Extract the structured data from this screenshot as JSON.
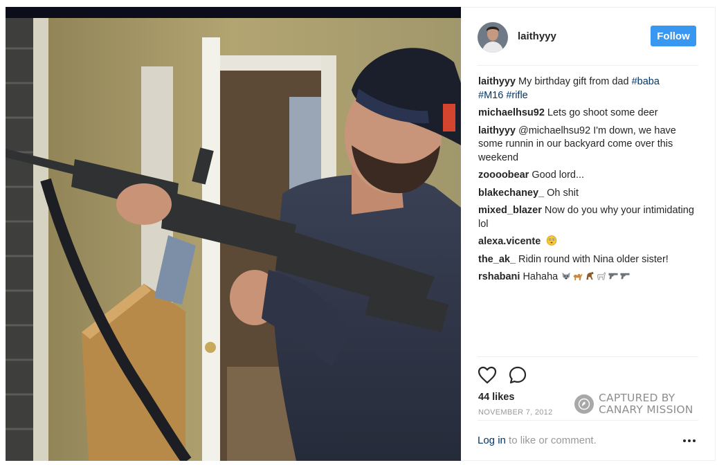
{
  "post": {
    "username": "laithyyy",
    "follow_label": "Follow",
    "photo_alt": "Man in backwards cap holding a rifle in a hallway"
  },
  "comments": [
    {
      "author": "laithyyy",
      "text": "My birthday gift from dad ",
      "tags": [
        "#baba",
        "#M16",
        "#rifle"
      ]
    },
    {
      "author": "michaelhsu92",
      "text": "Lets go shoot some deer"
    },
    {
      "author": "laithyyy",
      "text": "@michaelhsu92 I'm down, we have some runnin in our backyard come over this weekend"
    },
    {
      "author": "zoooobear",
      "text": "Good lord..."
    },
    {
      "author": "blakechaney_",
      "text": "Oh shit"
    },
    {
      "author": "mixed_blazer",
      "text": "Now do you why your intimidating lol"
    },
    {
      "author": "alexa.vicente",
      "text": ""
    },
    {
      "author": "the_ak_",
      "text": "Ridin round with Nina older sister!"
    },
    {
      "author": "rshabani",
      "text": "Hahaha"
    }
  ],
  "engagement": {
    "likes": "44 likes",
    "date": "NOVEMBER 7, 2012"
  },
  "watermark": {
    "line1": "CAPTURED BY",
    "line2": "CANARY MISSION"
  },
  "footer": {
    "login_label": "Log in",
    "login_suffix": " to like or comment."
  },
  "icons": {
    "like": "heart-outline-icon",
    "comment": "speech-bubble-icon",
    "more": "ellipsis-icon",
    "watermark": "canary-bird-icon"
  },
  "colors": {
    "follow_bg": "#3897f0",
    "link": "#003569",
    "muted": "#999999"
  }
}
